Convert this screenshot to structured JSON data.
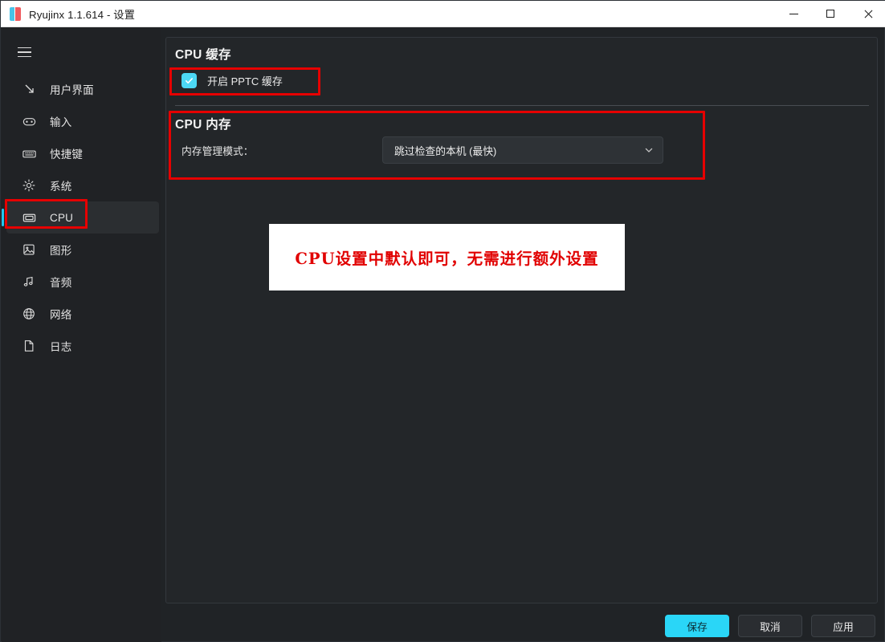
{
  "window": {
    "title": "Ryujinx 1.1.614 - 设置",
    "logo_colors": {
      "left": "#47c3e8",
      "right": "#ef5a5e"
    },
    "controls": {
      "minimize": {
        "name": "minimize-button",
        "glyph": "—"
      },
      "maximize": {
        "name": "maximize-button",
        "glyph": "□"
      },
      "close": {
        "name": "close-button",
        "glyph": "✕"
      }
    }
  },
  "sidebar": {
    "menu_icon": "hamburger-menu-icon",
    "items": [
      {
        "label": "用户界面",
        "icon": "arrow-down-right-icon",
        "selected": false
      },
      {
        "label": "输入",
        "icon": "gamepad-icon",
        "selected": false
      },
      {
        "label": "快捷键",
        "icon": "keyboard-icon",
        "selected": false
      },
      {
        "label": "系统",
        "icon": "gear-icon",
        "selected": false
      },
      {
        "label": "CPU",
        "icon": "cpu-chip-icon",
        "selected": true
      },
      {
        "label": "图形",
        "icon": "image-icon",
        "selected": false
      },
      {
        "label": "音频",
        "icon": "music-note-icon",
        "selected": false
      },
      {
        "label": "网络",
        "icon": "globe-icon",
        "selected": false
      },
      {
        "label": "日志",
        "icon": "document-icon",
        "selected": false
      }
    ]
  },
  "content": {
    "cache_section": {
      "title": "CPU 缓存",
      "checkbox": {
        "label": "开启 PPTC 缓存",
        "checked": true,
        "color": "#4cd8f5"
      }
    },
    "memory_section": {
      "title": "CPU 内存",
      "field_label": "内存管理模式：",
      "dropdown": {
        "value": "跳过检查的本机 (最快)",
        "chevron": "chevron-down-icon"
      }
    },
    "annotation": {
      "text": "CPU设置中默认即可，无需进行额外设置",
      "text_color": "#e10000",
      "background": "#ffffff"
    },
    "highlight_color": "#e60000"
  },
  "footer": {
    "save_label": "保存",
    "cancel_label": "取消",
    "apply_label": "应用",
    "primary_color": "#2ad6f7"
  }
}
